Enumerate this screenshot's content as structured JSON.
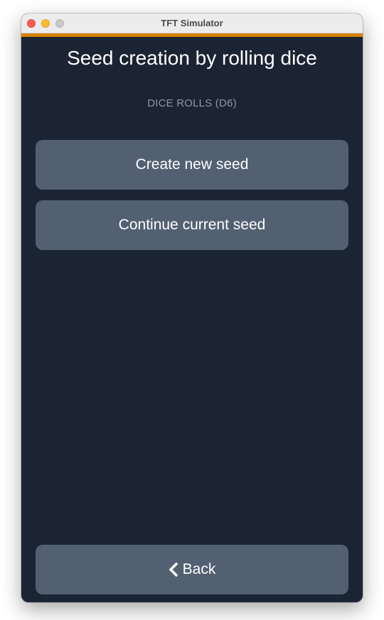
{
  "window": {
    "title": "TFT Simulator",
    "accent_color": "#d68100",
    "background_color": "#1b2433"
  },
  "header": {
    "title": "Seed creation by rolling dice",
    "subtitle": "DICE ROLLS (D6)"
  },
  "actions": {
    "create_label": "Create new seed",
    "continue_label": "Continue current seed"
  },
  "footer": {
    "back_label": "Back",
    "back_icon": "chevron-left-icon"
  }
}
